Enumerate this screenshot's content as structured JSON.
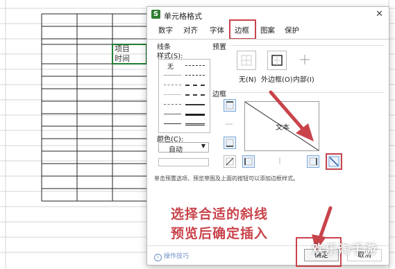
{
  "sheet": {
    "cell_line1": "项目",
    "cell_line2": "时间"
  },
  "dialog": {
    "title": "单元格格式",
    "close_icon": "close-icon",
    "tabs": [
      "数字",
      "对齐",
      "字体",
      "边框",
      "图案",
      "保护"
    ],
    "active_tab": "边框",
    "line_section": {
      "title": "线条",
      "style_label": "样式(S):",
      "none_label": "无"
    },
    "color": {
      "label": "颜色(C):",
      "value": "自动"
    },
    "presets": {
      "title": "预置",
      "none": "无(N)",
      "outline": "外边框(O)",
      "inside": "内部(I)"
    },
    "border": {
      "title": "边框",
      "preview_text": "文本"
    },
    "hint": "单击预置选项、预览草图及上面的按钮可以添加边框样式。",
    "tips_link": "操作技巧",
    "ok_label": "确定",
    "cancel_label": "取消"
  },
  "annotation": {
    "line1": "选择合适的斜线",
    "line2": "预览后确定插入",
    "color": "#c9434b"
  },
  "watermark": "欢乐淘手游"
}
